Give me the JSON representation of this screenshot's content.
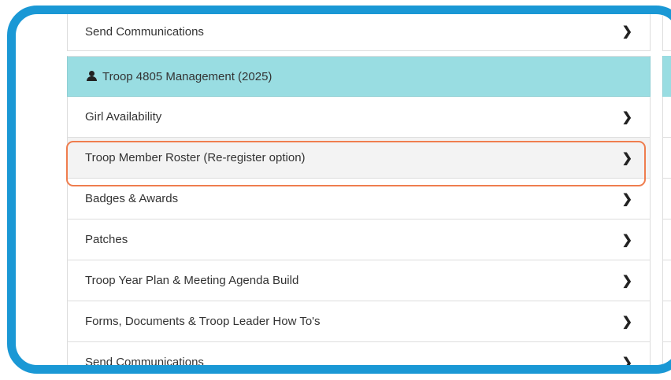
{
  "top_item": {
    "label": "Send Communications"
  },
  "management": {
    "header": "Troop 4805 Management (2025)",
    "items": [
      {
        "label": "Girl Availability"
      },
      {
        "label": "Troop Member Roster (Re-register option)"
      },
      {
        "label": "Badges & Awards"
      },
      {
        "label": "Patches"
      },
      {
        "label": "Troop Year Plan & Meeting Agenda Build"
      },
      {
        "label": "Forms, Documents & Troop Leader How To's"
      },
      {
        "label": "Send Communications"
      }
    ]
  },
  "colors": {
    "frame": "#1a98d5",
    "header_bg": "#99dde2",
    "highlight": "#ef7d4e"
  },
  "icons": {
    "header": "user-icon",
    "row": "chevron-right-icon"
  }
}
